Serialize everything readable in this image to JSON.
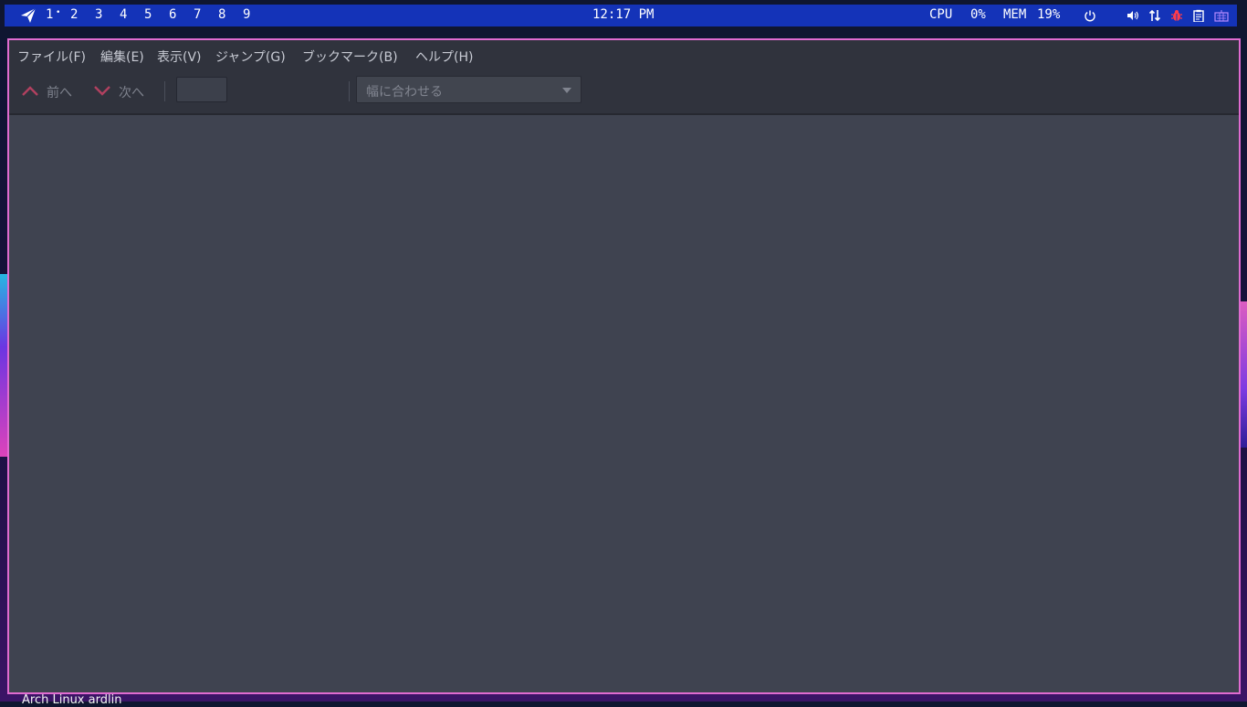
{
  "panel": {
    "workspaces": [
      "1",
      "2",
      "3",
      "4",
      "5",
      "6",
      "7",
      "8",
      "9"
    ],
    "active_workspace_marker": "•",
    "clock": "12:17 PM",
    "cpu_label": "CPU",
    "cpu_value": "0%",
    "mem_label": "MEM",
    "mem_value": "19%",
    "tray_icons": [
      "power-icon",
      "volume-icon",
      "network-icon",
      "bug-icon",
      "clipboard-icon",
      "keyboard-icon"
    ]
  },
  "window": {
    "menu": [
      "ファイル(F)",
      "編集(E)",
      "表示(V)",
      "ジャンプ(G)",
      "ブックマーク(B)",
      "ヘルプ(H)"
    ],
    "toolbar": {
      "prev_label": "前へ",
      "next_label": "次へ",
      "page_value": "",
      "zoom_value": "幅に合わせる"
    }
  },
  "desktop": {
    "bottom_text": "Arch Linux                        ardlin"
  },
  "colors": {
    "panel_bg": "#1433b8",
    "window_border": "#e06bd0",
    "chrome_bg": "#30333d",
    "content_bg": "#3f4350",
    "nav_arrow": "#b0405f",
    "bug_icon": "#ff3c4a"
  }
}
